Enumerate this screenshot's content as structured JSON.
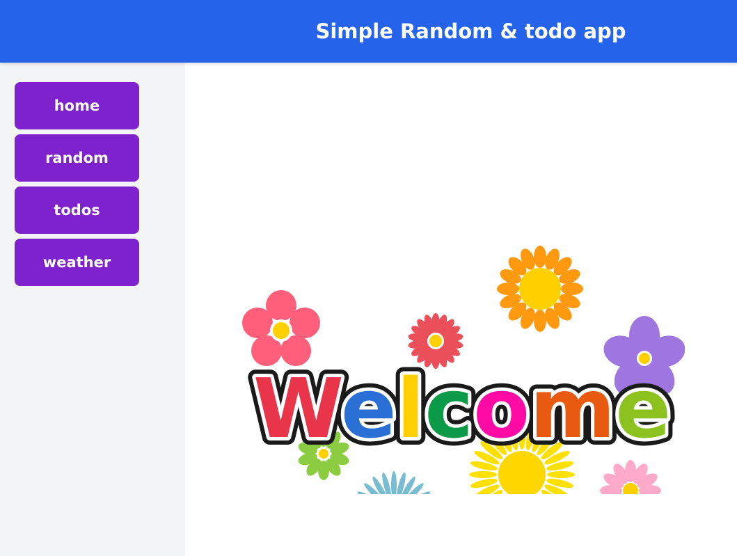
{
  "header": {
    "title": "Simple Random & todo app"
  },
  "sidebar": {
    "items": [
      {
        "label": "home"
      },
      {
        "label": "random"
      },
      {
        "label": "todos"
      },
      {
        "label": "weather"
      }
    ]
  },
  "main": {
    "welcome_image": {
      "text": "Welcome",
      "letter_colors": [
        "#e8354a",
        "#2a6fd6",
        "#ffd000",
        "#0a9a48",
        "#ff0aa5",
        "#e85a10",
        "#8cc21f"
      ]
    }
  },
  "colors": {
    "header_bg": "#2563eb",
    "sidebar_bg": "#f3f4f6",
    "button_bg": "#7e22ce",
    "button_text": "#ffffff"
  }
}
